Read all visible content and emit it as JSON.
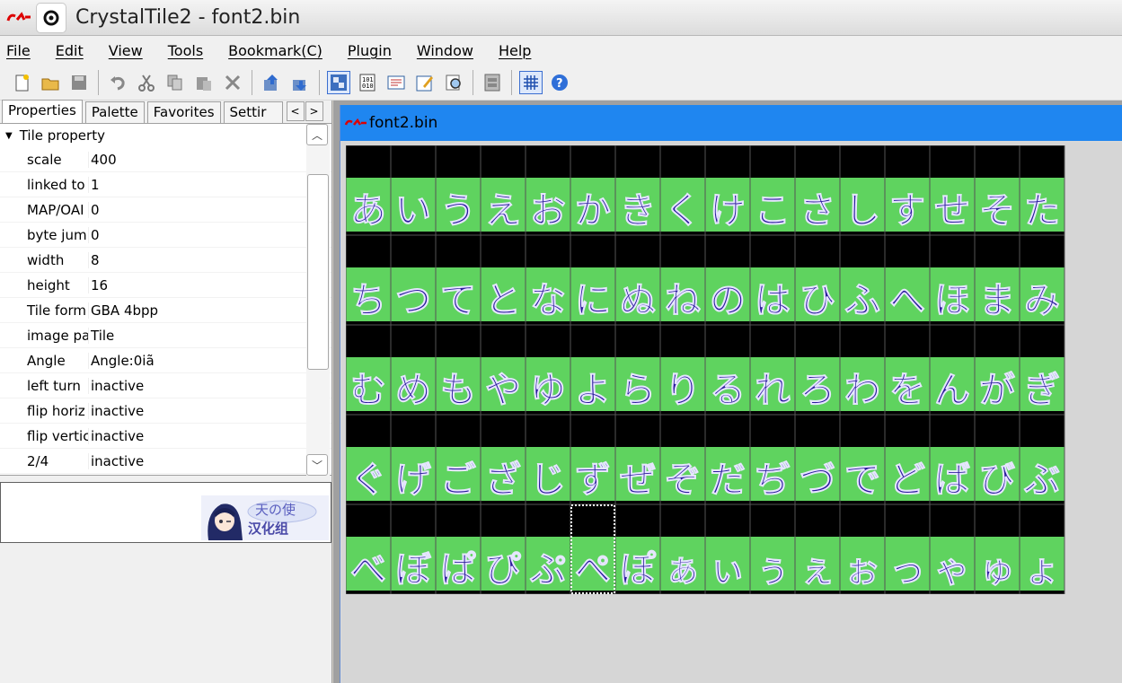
{
  "window": {
    "title": "CrystalTile2 - font2.bin",
    "app_icon": "crystaltile-logo-icon"
  },
  "menu": [
    "File",
    "Edit",
    "View",
    "Tools",
    "Bookmark(C)",
    "Plugin",
    "Window",
    "Help"
  ],
  "toolbar": {
    "buttons": [
      "new-file-icon",
      "open-folder-icon",
      "save-icon",
      "undo-icon",
      "cut-icon",
      "copy-icon",
      "paste-icon",
      "delete-icon",
      "import-icon",
      "export-icon",
      "tile-view-icon",
      "hex-view-icon",
      "text-view-icon",
      "edit-icon",
      "search-icon",
      "compare-icon",
      "grid-icon",
      "help-icon"
    ],
    "active": [
      "tile-view-icon",
      "grid-icon"
    ]
  },
  "tabs": {
    "items": [
      "Properties",
      "Palette",
      "Favorites",
      "Settir"
    ],
    "active": "Properties",
    "scroll_left": "<",
    "scroll_right": ">"
  },
  "properties": {
    "group": "Tile property",
    "rows": [
      {
        "name": "scale",
        "value": "400"
      },
      {
        "name": "linked to",
        "value": "1"
      },
      {
        "name": "MAP/OAI",
        "value": "0"
      },
      {
        "name": "byte jum",
        "value": "0"
      },
      {
        "name": "width",
        "value": "8"
      },
      {
        "name": "height",
        "value": "16"
      },
      {
        "name": "Tile form",
        "value": "GBA 4bpp"
      },
      {
        "name": "image pa",
        "value": "Tile"
      },
      {
        "name": "Angle",
        "value": "Angle:0iã"
      },
      {
        "name": "left turn",
        "value": "inactive"
      },
      {
        "name": "flip horiz",
        "value": "inactive"
      },
      {
        "name": "flip vertic",
        "value": "inactive"
      },
      {
        "name": "2/4",
        "value": "inactive"
      }
    ]
  },
  "logo": {
    "line1": "天の使",
    "line2": "汉化组"
  },
  "document": {
    "title": "font2.bin",
    "grid_columns": 16,
    "grid_rows": 5,
    "rows": [
      "あいうえおかきくけこさしすせそた",
      "ちつてとなにぬねのはひふへほまみ",
      "むめもやゆよらりるれろわをんがぎ",
      "ぐげござじずぜぞだぢづでどばびぶ",
      "べぼぱぴぷぺぽぁぃぅぇぉっゃゅょ"
    ],
    "selected_row": 4,
    "selected_col": 5,
    "colors": {
      "background": "#000000",
      "glyph_fill": "#2c1a9e",
      "outline": "#5fd35f",
      "highlight": "#e6e6ff",
      "grid": "#555555"
    }
  }
}
